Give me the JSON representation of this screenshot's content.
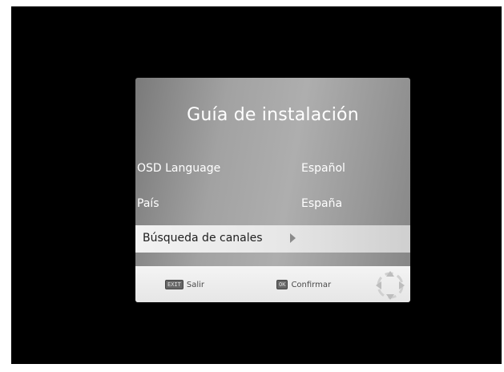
{
  "dialog": {
    "title": "Guía de instalación",
    "rows": [
      {
        "label": "OSD Language",
        "value": "Español"
      },
      {
        "label": "País",
        "value": "España"
      },
      {
        "label": "Búsqueda de canales",
        "value": ""
      }
    ]
  },
  "footer": {
    "exit_key": "EXIT",
    "exit_label": "Salir",
    "ok_key": "OK",
    "ok_label": "Confirmar"
  },
  "icons": {
    "dpad": "dpad-icon",
    "arrow": "right-arrow-icon"
  },
  "colors": {
    "background": "#000000",
    "highlight": "#f2f2f2",
    "text": "#ffffff"
  }
}
